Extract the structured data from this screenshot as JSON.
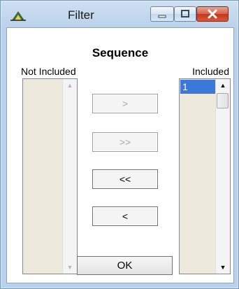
{
  "window": {
    "title": "Filter",
    "icons": {
      "app": "app-logo-icon",
      "minimize": "minimize-icon",
      "maximize": "maximize-icon",
      "close": "close-icon"
    }
  },
  "dialog": {
    "heading": "Sequence",
    "not_included_label": "Not Included",
    "included_label": "Included",
    "not_included_items": [],
    "included_items": [
      "1"
    ],
    "buttons": {
      "add_one": ">",
      "add_all": ">>",
      "remove_all": "<<",
      "remove_one": "<"
    },
    "ok_label": "OK"
  },
  "colors": {
    "selection": "#3b78d8",
    "list_background": "#ede9dc",
    "close_button": "#c4361b"
  }
}
